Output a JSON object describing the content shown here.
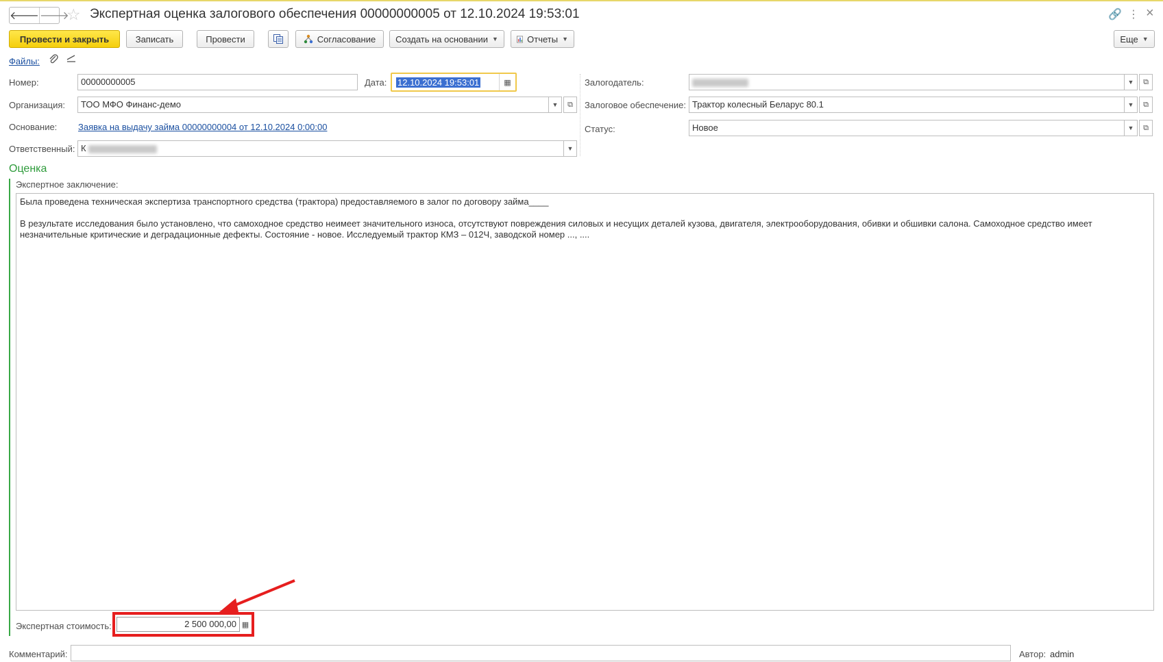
{
  "window": {
    "title": "Экспертная оценка залогового обеспечения 00000000005 от 12.10.2024 19:53:01",
    "nav_back": "🡐",
    "nav_forward": "🡒",
    "star": "☆",
    "link_icon": "🔗",
    "more_icon": "⋮",
    "close_icon": "×"
  },
  "toolbar": {
    "post_close": "Провести и закрыть",
    "save": "Записать",
    "post": "Провести",
    "approval": "Согласование",
    "create_based": "Создать на основании",
    "reports": "Отчеты",
    "more": "Еще"
  },
  "files": {
    "label": "Файлы:"
  },
  "form": {
    "number_label": "Номер:",
    "number_value": "00000000005",
    "date_label": "Дата:",
    "date_value": "12.10.2024 19:53:01",
    "org_label": "Организация:",
    "org_value": "ТОО МФО Финанс-демо",
    "basis_label": "Основание:",
    "basis_value": "Заявка на выдачу займа 00000000004 от 12.10.2024 0:00:00",
    "responsible_label": "Ответственный:",
    "responsible_value": "К",
    "pledger_label": "Залогодатель:",
    "pledger_value": "",
    "collateral_label": "Залоговое обеспечение:",
    "collateral_value": "Трактор колесный Беларус 80.1",
    "status_label": "Статус:",
    "status_value": "Новое"
  },
  "evaluation": {
    "section_title": "Оценка",
    "conclusion_label": "Экспертное заключение:",
    "conclusion_line1": "Была проведена техническая экспертиза транспортного средства (трактора) предоставляемого в залог по договору займа____",
    "conclusion_line2": "В результате исследования было установлено, что самоходное средство неимеет значительного износа, отсутствуют повреждения силовых и несущих деталей кузова, двигателя, электрооборудования, обивки и обшивки салона.  Самоходное средство имеет",
    "conclusion_line3": "незначительные критические и деградационные дефекты. Состояние - новое.  Исследуемый трактор КМЗ – 012Ч, заводской номер ..., ....",
    "cost_label": "Экспертная стоимость:",
    "cost_value": "2 500 000,00"
  },
  "footer": {
    "comment_label": "Комментарий:",
    "comment_value": "",
    "author_label": "Автор:",
    "author_value": "admin"
  },
  "colors": {
    "primary_button": "#f5cf0c",
    "section_green": "#2e9b3b",
    "highlight_red": "#e61e1e",
    "link_blue": "#1a4fa0"
  }
}
